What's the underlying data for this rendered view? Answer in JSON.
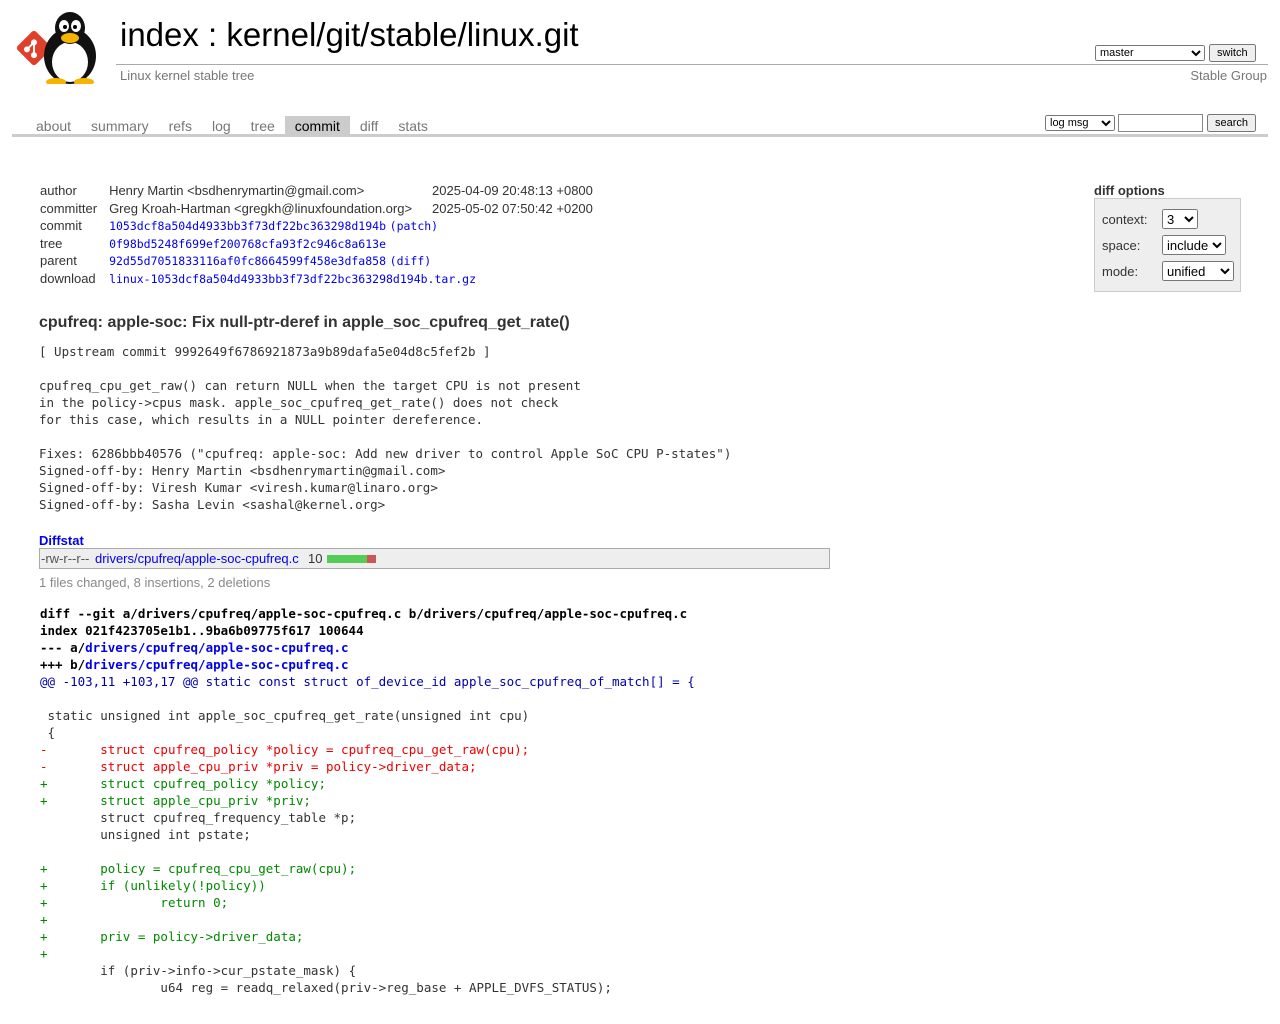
{
  "header": {
    "title_prefix": "index",
    "title_sep": " : ",
    "title_repo": "kernel/git/stable/linux.git",
    "subtitle": "Linux kernel stable tree",
    "branch_selected": "master",
    "switch_label": "switch",
    "group_label": "Stable Group"
  },
  "tabs": [
    {
      "label": "about"
    },
    {
      "label": "summary"
    },
    {
      "label": "refs"
    },
    {
      "label": "log"
    },
    {
      "label": "tree"
    },
    {
      "label": "commit",
      "active": true
    },
    {
      "label": "diff"
    },
    {
      "label": "stats"
    }
  ],
  "search": {
    "scope_selected": "log msg",
    "query": "",
    "button_label": "search"
  },
  "commit_info": {
    "author_label": "author",
    "author": "Henry Martin <bsdhenrymartin@gmail.com>",
    "author_date": "2025-04-09 20:48:13 +0800",
    "committer_label": "committer",
    "committer": "Greg Kroah-Hartman <gregkh@linuxfoundation.org>",
    "committer_date": "2025-05-02 07:50:42 +0200",
    "commit_label": "commit",
    "commit_hash": "1053dcf8a504d4933bb3f73df22bc363298d194b",
    "commit_link": "(patch)",
    "tree_label": "tree",
    "tree_hash": "0f98bd5248f699ef200768cfa93f2c946c8a613e",
    "parent_label": "parent",
    "parent_hash": "92d55d7051833116af0fc8664599f458e3dfa858",
    "parent_link": "(diff)",
    "download_label": "download",
    "download_file": "linux-1053dcf8a504d4933bb3f73df22bc363298d194b.tar.gz"
  },
  "diff_options": {
    "title": "diff options",
    "context_label": "context:",
    "context_value": "3",
    "space_label": "space:",
    "space_value": "include",
    "mode_label": "mode:",
    "mode_value": "unified"
  },
  "subject": "cpufreq: apple-soc: Fix null-ptr-deref in apple_soc_cpufreq_get_rate()",
  "message": "[ Upstream commit 9992649f6786921873a9b89dafa5e04d8c5fef2b ]\n\ncpufreq_cpu_get_raw() can return NULL when the target CPU is not present\nin the policy->cpus mask. apple_soc_cpufreq_get_rate() does not check\nfor this case, which results in a NULL pointer dereference.\n\nFixes: 6286bbb40576 (\"cpufreq: apple-soc: Add new driver to control Apple SoC CPU P-states\")\nSigned-off-by: Henry Martin <bsdhenrymartin@gmail.com>\nSigned-off-by: Viresh Kumar <viresh.kumar@linaro.org>\nSigned-off-by: Sasha Levin <sashal@kernel.org>",
  "diffstat": {
    "title": "Diffstat",
    "mode": "-rw-r--r--",
    "file": "drivers/cpufreq/apple-soc-cpufreq.c",
    "changes": "10",
    "summary": "1 files changed, 8 insertions, 2 deletions"
  },
  "diff": {
    "git_line_prefix": "diff --git a/drivers/cpufreq/apple-soc-cpufreq.c b/drivers/cpufreq/apple-soc-cpufreq.c",
    "index_line": "index 021f423705e1b1..9ba6b09775f617 100644",
    "minus_prefix": "--- a/",
    "minus_file": "drivers/cpufreq/apple-soc-cpufreq.c",
    "plus_prefix": "+++ b/",
    "plus_file": "drivers/cpufreq/apple-soc-cpufreq.c",
    "hunk": "@@ -103,11 +103,17 @@ static const struct of_device_id apple_soc_cpufreq_of_match[] = {",
    "lines": [
      {
        "type": "ctx",
        "text": ""
      },
      {
        "type": "ctx",
        "text": " static unsigned int apple_soc_cpufreq_get_rate(unsigned int cpu)"
      },
      {
        "type": "ctx",
        "text": " {"
      },
      {
        "type": "del",
        "text": "-\tstruct cpufreq_policy *policy = cpufreq_cpu_get_raw(cpu);"
      },
      {
        "type": "del",
        "text": "-\tstruct apple_cpu_priv *priv = policy->driver_data;"
      },
      {
        "type": "add",
        "text": "+\tstruct cpufreq_policy *policy;"
      },
      {
        "type": "add",
        "text": "+\tstruct apple_cpu_priv *priv;"
      },
      {
        "type": "ctx",
        "text": " \tstruct cpufreq_frequency_table *p;"
      },
      {
        "type": "ctx",
        "text": " \tunsigned int pstate;"
      },
      {
        "type": "ctx",
        "text": " "
      },
      {
        "type": "add",
        "text": "+\tpolicy = cpufreq_cpu_get_raw(cpu);"
      },
      {
        "type": "add",
        "text": "+\tif (unlikely(!policy))"
      },
      {
        "type": "add",
        "text": "+\t\treturn 0;"
      },
      {
        "type": "add",
        "text": "+"
      },
      {
        "type": "add",
        "text": "+\tpriv = policy->driver_data;"
      },
      {
        "type": "add",
        "text": "+"
      },
      {
        "type": "ctx",
        "text": " \tif (priv->info->cur_pstate_mask) {"
      },
      {
        "type": "ctx",
        "text": " \t\tu64 reg = readq_relaxed(priv->reg_base + APPLE_DVFS_STATUS);"
      }
    ]
  }
}
